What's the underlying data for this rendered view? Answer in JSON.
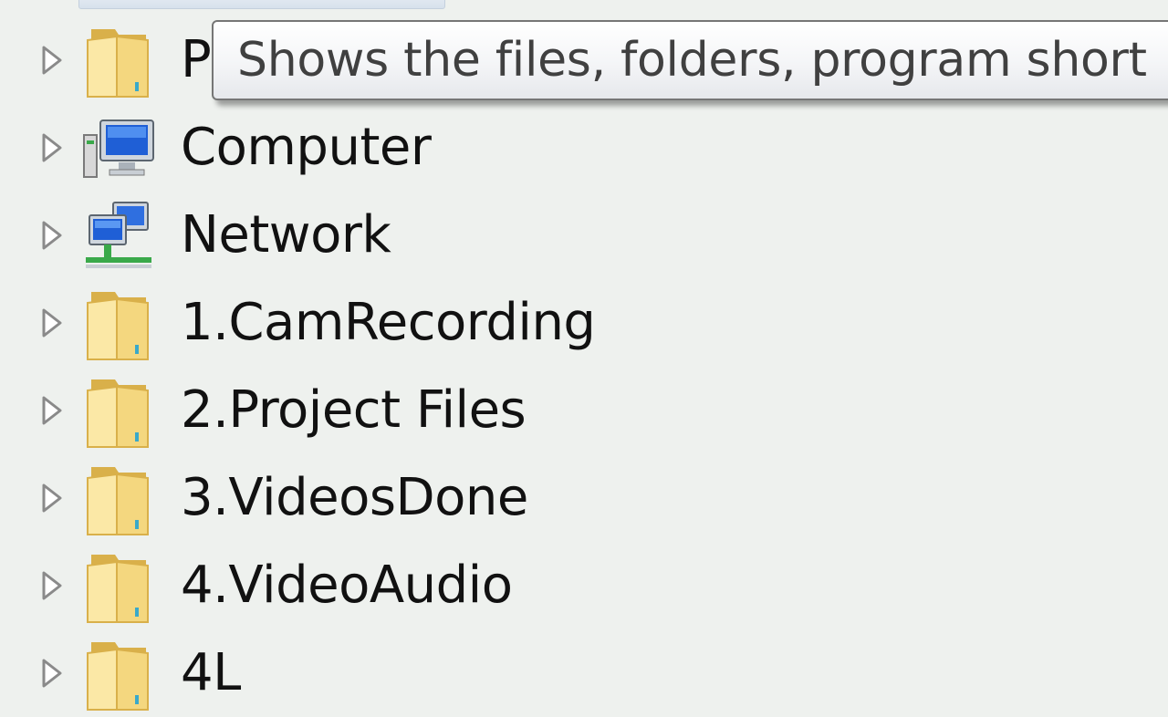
{
  "tree": {
    "top_partial_label": "",
    "items": [
      {
        "label": "P",
        "icon": "folder-icon"
      },
      {
        "label": "Computer",
        "icon": "computer-icon"
      },
      {
        "label": "Network",
        "icon": "network-icon"
      },
      {
        "label": "1.CamRecording",
        "icon": "folder-icon"
      },
      {
        "label": "2.Project Files",
        "icon": "folder-icon"
      },
      {
        "label": "3.VideosDone",
        "icon": "folder-icon"
      },
      {
        "label": "4.VideoAudio",
        "icon": "folder-icon"
      },
      {
        "label": "4L",
        "icon": "folder-icon"
      }
    ]
  },
  "tooltip": {
    "text": "Shows the files, folders, program short"
  },
  "colors": {
    "background": "#eef1ee",
    "folder_light": "#fbe8a6",
    "folder_dark": "#d9b04a",
    "expander": "#8a8a8a",
    "tooltip_border": "#767676",
    "tooltip_text": "#404040"
  }
}
